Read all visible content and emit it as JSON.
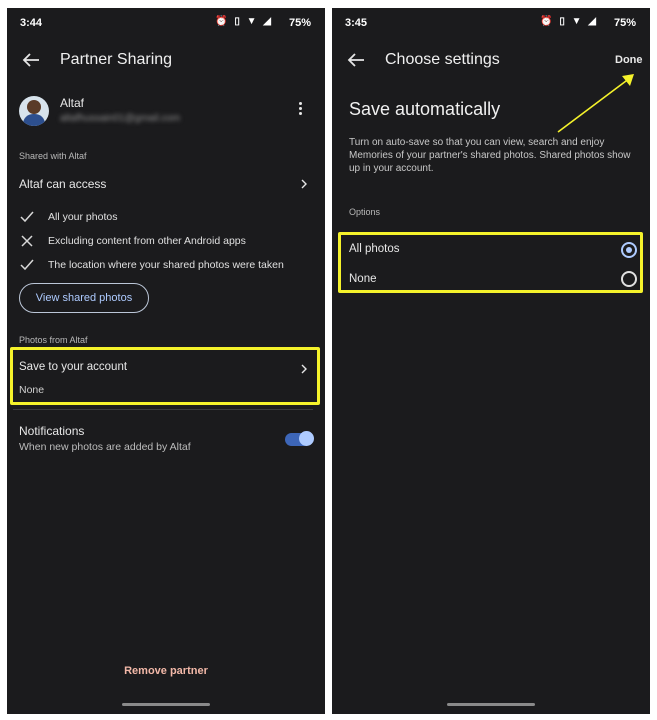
{
  "left": {
    "status": {
      "time": "3:44",
      "battery": "75%",
      "icons": "⏰ ▯ ▼ ◢"
    },
    "title": "Partner Sharing",
    "partner": {
      "name": "Altaf",
      "email": "altafhussain01@gmail.com"
    },
    "shared_with_label": "Shared with Altaf",
    "access_label": "Altaf can access",
    "access_items": [
      {
        "icon": "check-icon",
        "text": "All your photos"
      },
      {
        "icon": "close-icon",
        "text": "Excluding content from other Android apps"
      },
      {
        "icon": "check-icon",
        "text": "The location where your shared photos were taken"
      }
    ],
    "view_shared_button": "View shared photos",
    "photos_from_label": "Photos from Altaf",
    "save_row": {
      "label": "Save to your account",
      "value": "None"
    },
    "notifications": {
      "label": "Notifications",
      "sub": "When new photos are added by Altaf",
      "enabled": true
    },
    "remove_partner": "Remove partner"
  },
  "right": {
    "status": {
      "time": "3:45",
      "battery": "75%",
      "icons": "⏰ ▯ ▼ ◢"
    },
    "title": "Choose settings",
    "done": "Done",
    "heading": "Save automatically",
    "description": "Turn on auto-save so that you can view, search and enjoy Memories of your partner's shared photos. Shared photos show up in your account.",
    "options_label": "Options",
    "options": [
      {
        "label": "All photos",
        "selected": true
      },
      {
        "label": "None",
        "selected": false
      }
    ]
  },
  "colors": {
    "highlight": "#f5f22b",
    "accent": "#aecbff",
    "remove": "#f2b8a8"
  }
}
